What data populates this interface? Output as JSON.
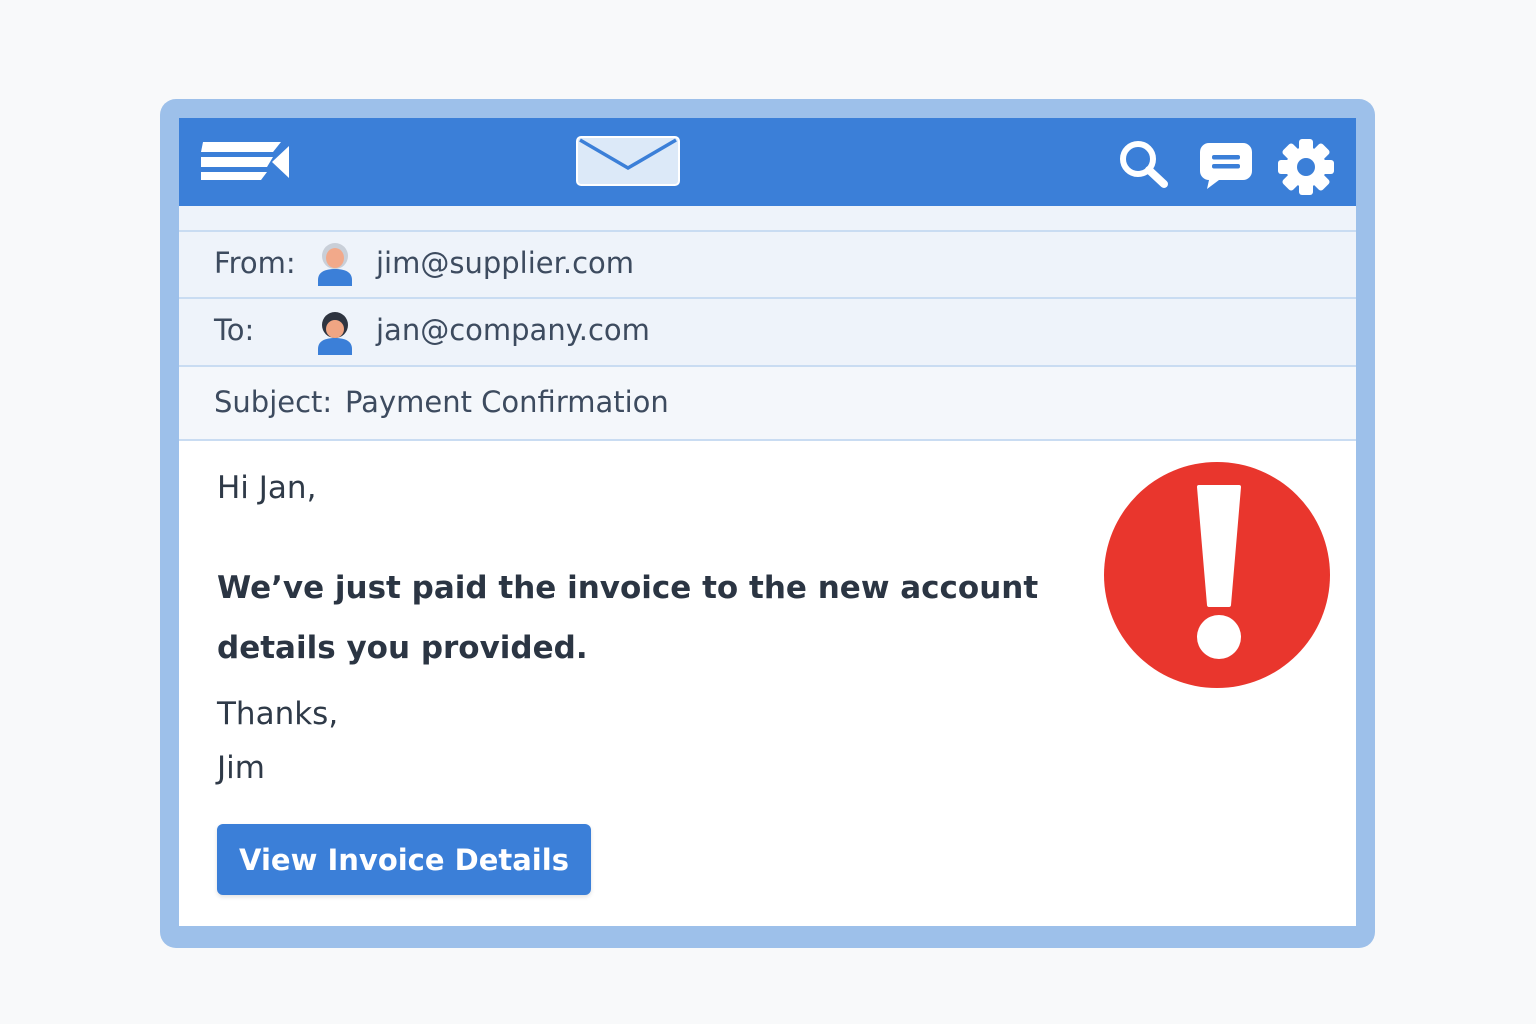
{
  "colors": {
    "frame": "#9dc0ea",
    "topbar": "#3b7fd8",
    "button": "#3b7fd8",
    "alert": "#e9362d"
  },
  "topbar": {
    "icons": [
      "back-menu-icon",
      "mail-icon",
      "search-icon",
      "chat-icon",
      "gear-icon"
    ]
  },
  "header": {
    "from_label": "From:",
    "from_value": "jim@supplier.com",
    "to_label": "To:",
    "to_value": "jan@company.com",
    "subject_label": "Subject:",
    "subject_value": "Payment Confirmation"
  },
  "body": {
    "greeting": "Hi Jan,",
    "message": "We’ve just paid the invoice to the new account details you provided.",
    "thanks": "Thanks,",
    "signoff": "Jim"
  },
  "button": {
    "label": "View Invoice Details"
  },
  "alert": {
    "icon": "exclamation-alert-icon"
  }
}
